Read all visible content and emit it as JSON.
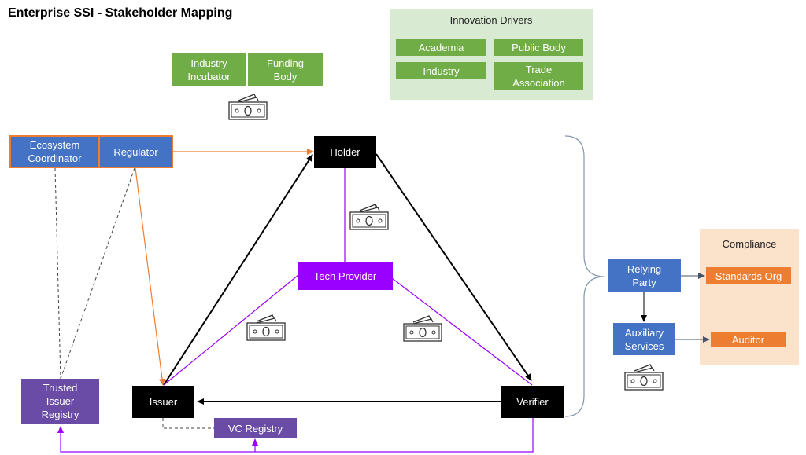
{
  "title": "Enterprise SSI - Stakeholder Mapping",
  "innovation_drivers": {
    "label": "Innovation Drivers",
    "items": [
      "Academia",
      "Public Body",
      "Industry",
      "Trade Association"
    ]
  },
  "funding": {
    "industry_incubator": "Industry Incubator",
    "funding_body": "Funding Body"
  },
  "governance": {
    "ecosystem_coordinator": "Ecosystem Coordinator",
    "regulator": "Regulator"
  },
  "triangle": {
    "holder": "Holder",
    "issuer": "Issuer",
    "verifier": "Verifier",
    "tech_provider": "Tech Provider"
  },
  "registries": {
    "trusted_issuer_registry": "Trusted Issuer Registry",
    "vc_registry": "VC Registry"
  },
  "relying": {
    "relying_party": "Relying Party",
    "auxiliary_services": "Auxiliary Services"
  },
  "compliance": {
    "label": "Compliance",
    "standards_org": "Standards Org",
    "auditor": "Auditor"
  },
  "icons": {
    "payment": "money-bill-icon"
  },
  "colors": {
    "green": "#70ad47",
    "blue": "#4472c4",
    "orange": "#ed7d31",
    "purple": "#9900ff",
    "violet": "#6a4ba6",
    "black": "#000000"
  }
}
